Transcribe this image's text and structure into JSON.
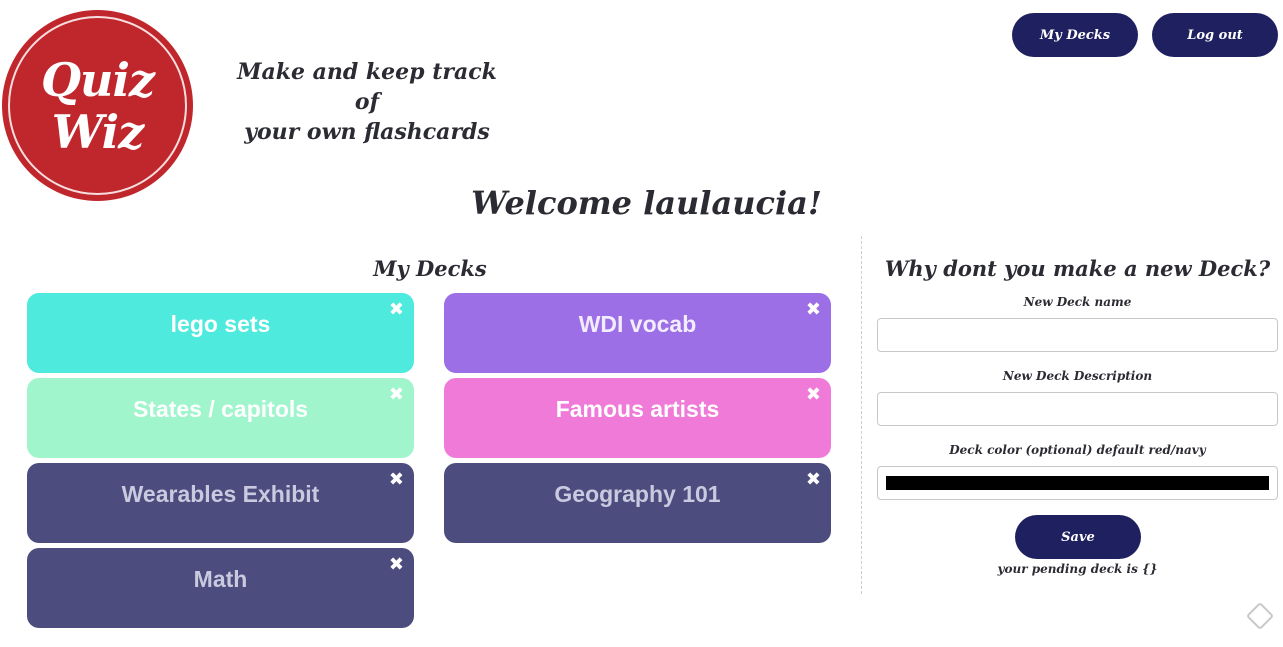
{
  "header": {
    "logo_line1": "Quiz",
    "logo_line2": "Wiz",
    "tagline_line1": "Make and keep track of",
    "tagline_line2": "your own flashcards",
    "nav": {
      "my_decks": "My Decks",
      "log_out": "Log out"
    }
  },
  "welcome": "Welcome laulaucia!",
  "decks": {
    "title": "My Decks",
    "delete_glyph": "✖",
    "items": [
      {
        "name": "lego sets",
        "bg": "#4deadd",
        "fg": "#ffffff"
      },
      {
        "name": "WDI vocab",
        "bg": "#9d6fe6",
        "fg": "#f2ecff"
      },
      {
        "name": "States / capitols",
        "bg": "#a0f5cd",
        "fg": "#ffffff"
      },
      {
        "name": "Famous artists",
        "bg": "#f07ad8",
        "fg": "#ffffff"
      },
      {
        "name": "Wearables Exhibit",
        "bg": "#4c4c7e",
        "fg": "#c9c9df"
      },
      {
        "name": "Geography 101",
        "bg": "#4c4c7e",
        "fg": "#c9c9df"
      },
      {
        "name": "Math",
        "bg": "#4c4c7e",
        "fg": "#c9c9df"
      }
    ]
  },
  "new_deck_form": {
    "title": "Why dont you make a new Deck?",
    "name_label": "New Deck name",
    "name_value": "",
    "description_label": "New Deck Description",
    "description_value": "",
    "color_label": "Deck color  (optional) default red/navy",
    "color_value": "#000000",
    "save_label": "Save",
    "pending_text": "your pending deck is {}"
  },
  "colors": {
    "brand_red": "#c0272d",
    "navy": "#1f2060"
  }
}
